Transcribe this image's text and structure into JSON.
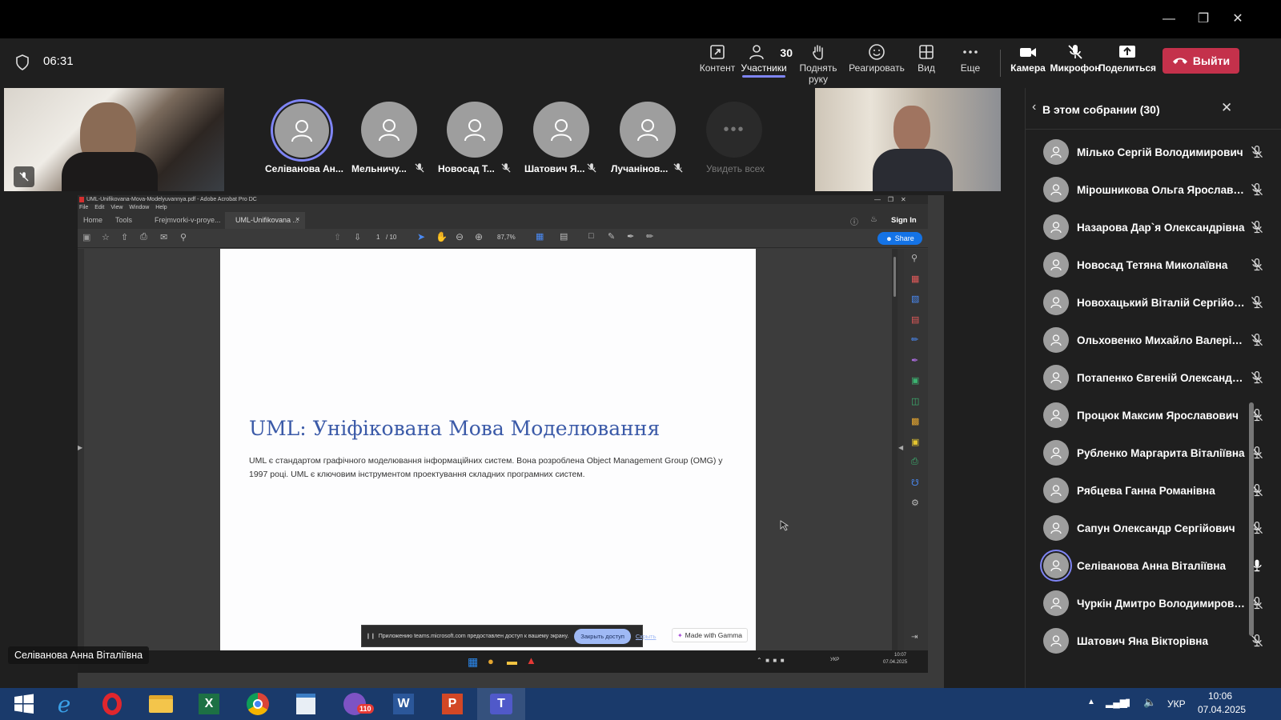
{
  "meeting": {
    "timer": "06:31",
    "participants_count": "30",
    "toolbar": {
      "content": "Контент",
      "participants": "Участники",
      "raise_hand": "Поднять руку",
      "react": "Реагировать",
      "view": "Вид",
      "more": "Еще",
      "camera": "Камера",
      "mic": "Микрофон",
      "share": "Поделиться",
      "leave": "Выйти"
    }
  },
  "gallery": {
    "tiles": [
      {
        "name": "Селіванова Ан..."
      },
      {
        "name": "Мельничу..."
      },
      {
        "name": "Новосад Т..."
      },
      {
        "name": "Шатович Я..."
      },
      {
        "name": "Лучанінов..."
      }
    ],
    "see_all": "Увидеть всех"
  },
  "presenter_label": "Селіванова Анна Віталіївна",
  "panel": {
    "title": "В этом собрании (30)",
    "participants": [
      {
        "name": "Мілько Сергій Володимирович",
        "muted": true
      },
      {
        "name": "Мірошникова Ольга Ярославів...",
        "muted": true
      },
      {
        "name": "Назарова Дар`я Олександрівна",
        "muted": true
      },
      {
        "name": "Новосад Тетяна Миколаївна",
        "muted": true
      },
      {
        "name": "Новохацький Віталій Сергійович",
        "muted": true
      },
      {
        "name": "Ольховенко Михайло Валерійо...",
        "muted": true
      },
      {
        "name": "Потапенко Євгеній Олександро...",
        "muted": true
      },
      {
        "name": "Процюк Максим Ярославович",
        "muted": true
      },
      {
        "name": "Рубленко Маргарита Віталіївна",
        "muted": true
      },
      {
        "name": "Рябцева Ганна Романівна",
        "muted": true
      },
      {
        "name": "Сапун Олександр Сергійович",
        "muted": true
      },
      {
        "name": "Селіванова Анна Віталіївна",
        "muted": false
      },
      {
        "name": "Чуркін Дмитро Володимирович",
        "muted": true
      },
      {
        "name": "Шатович Яна Вікторівна",
        "muted": true
      }
    ]
  },
  "shared": {
    "window_title": "UML-Unifikovana-Mova-Modelyuvannya.pdf - Adobe Acrobat Pro DC",
    "menu": [
      "File",
      "Edit",
      "View",
      "Window",
      "Help"
    ],
    "tabs": {
      "home": "Home",
      "tools": "Tools",
      "tab1": "Frejmvorki-v-proye...",
      "tab2": "UML-Unifikovana ..."
    },
    "sign_in": "Sign In",
    "share_btn": "Share",
    "page_indicator": "1",
    "page_total": "/ 10",
    "zoom": "87,7%",
    "slide_title": "UML: Уніфікована Мова Моделювання",
    "slide_text_1": "UML є стандартом графічного моделювання інформаційних систем. Вона розроблена Object Management Group (OMG) у",
    "slide_text_2": "1997 році. UML є ключовим інструментом проектування складних програмних систем.",
    "gamma_badge": "Made with Gamma",
    "notice_text": "Приложению teams.microsoft.com предоставлен доступ к вашему экрану.",
    "notice_close": "Закрыть доступ",
    "notice_hide": "Скрыть",
    "inner_clock_time": "10:07",
    "inner_clock_date": "07.04.2025",
    "inner_lang": "УКР"
  },
  "taskbar": {
    "lang": "УКР",
    "time": "10:06",
    "date": "07.04.2025",
    "viber_badge": "110"
  },
  "colors": {
    "leave": "#c4314b",
    "accent": "#7f85f5",
    "slide_title": "#3b5aa8",
    "taskbar": "#1a3a6b"
  }
}
